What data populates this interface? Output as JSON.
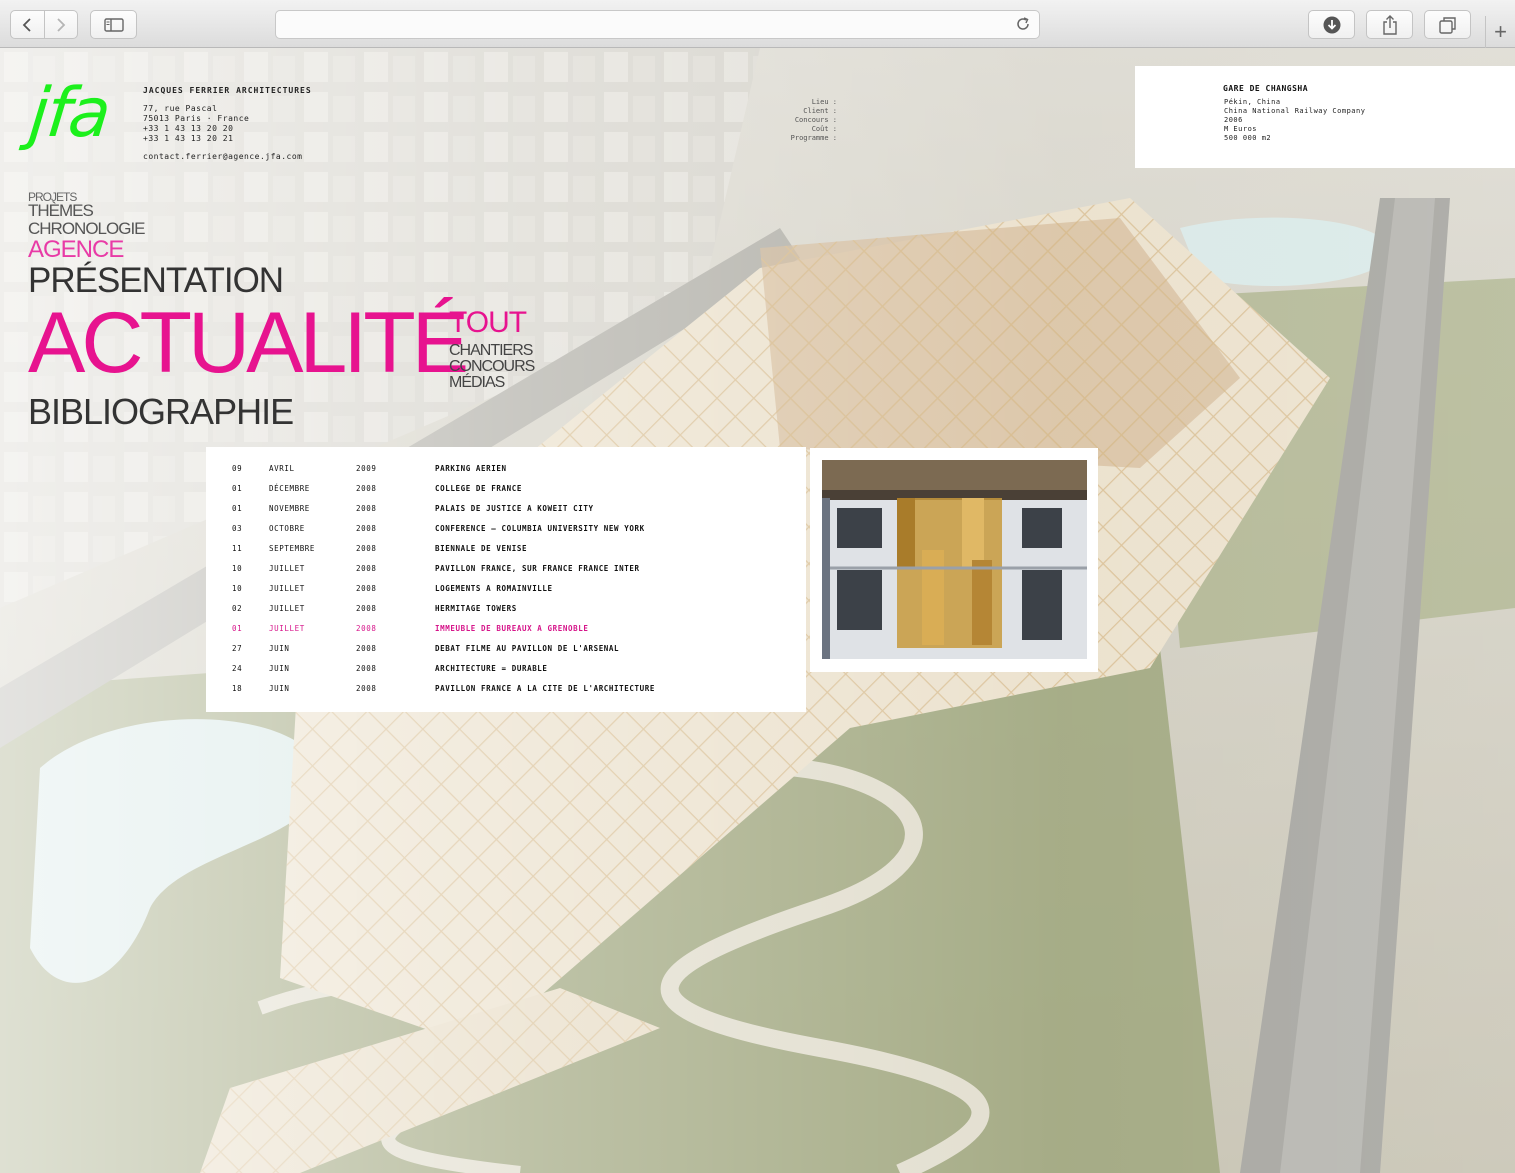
{
  "browser": {
    "back_icon": "chevron-left-icon",
    "forward_icon": "chevron-right-icon",
    "sidebar_icon": "sidebar-icon",
    "reload_icon": "reload-icon",
    "download_icon": "download-icon",
    "share_icon": "share-icon",
    "tabs_icon": "tabs-icon",
    "newtab_label": "+"
  },
  "header": {
    "logo": "jfa",
    "firm": "JACQUES FERRIER ARCHITECTURES",
    "street": "77, rue Pascal",
    "city": "75013 Paris · France",
    "phone": "+33 1 43 13 20 20",
    "fax": "+33 1 43 13 20 21",
    "email": "contact.ferrier@agence.jfa.com"
  },
  "nav": {
    "projets": "PROJETS",
    "themes": "THÈMES",
    "chronologie": "CHRONOLOGIE",
    "agence": "AGENCE",
    "presentation": "PRÉSENTATION",
    "actualite": "ACTUALITÉ",
    "bibliographie": "BIBLIOGRAPHIE",
    "sub": {
      "tout": "TOUT",
      "chantiers": "CHANTIERS",
      "concours": "CONCOURS",
      "medias": "MÉDIAS"
    }
  },
  "project": {
    "title": "GARE DE CHANGSHA",
    "fields": [
      {
        "label": "Lieu :",
        "value": "Pékin, China"
      },
      {
        "label": "Client :",
        "value": "China National Railway Company"
      },
      {
        "label": "Concours :",
        "value": "2006"
      },
      {
        "label": "Coût :",
        "value": "M Euros"
      },
      {
        "label": "Programme :",
        "value": "500 000 m2"
      }
    ]
  },
  "news": [
    {
      "day": "09",
      "month": "AVRIL",
      "year": "2009",
      "title": "PARKING AERIEN"
    },
    {
      "day": "01",
      "month": "DÉCEMBRE",
      "year": "2008",
      "title": "COLLEGE DE FRANCE"
    },
    {
      "day": "01",
      "month": "NOVEMBRE",
      "year": "2008",
      "title": "PALAIS DE JUSTICE A KOWEIT CITY"
    },
    {
      "day": "03",
      "month": "OCTOBRE",
      "year": "2008",
      "title": "CONFERENCE – COLUMBIA UNIVERSITY NEW YORK"
    },
    {
      "day": "11",
      "month": "SEPTEMBRE",
      "year": "2008",
      "title": "BIENNALE DE VENISE"
    },
    {
      "day": "10",
      "month": "JUILLET",
      "year": "2008",
      "title": "PAVILLON FRANCE, SUR FRANCE FRANCE INTER"
    },
    {
      "day": "10",
      "month": "JUILLET",
      "year": "2008",
      "title": "LOGEMENTS A ROMAINVILLE"
    },
    {
      "day": "02",
      "month": "JUILLET",
      "year": "2008",
      "title": "HERMITAGE TOWERS"
    },
    {
      "day": "01",
      "month": "JUILLET",
      "year": "2008",
      "title": "IMMEUBLE DE BUREAUX A GRENOBLE"
    },
    {
      "day": "27",
      "month": "JUIN",
      "year": "2008",
      "title": "DEBAT FILME AU PAVILLON DE L'ARSENAL"
    },
    {
      "day": "24",
      "month": "JUIN",
      "year": "2008",
      "title": "ARCHITECTURE = DURABLE"
    },
    {
      "day": "18",
      "month": "JUIN",
      "year": "2008",
      "title": "PAVILLON FRANCE A LA CITE DE L'ARCHITECTURE"
    }
  ],
  "active_news_index": 8,
  "colors": {
    "logo_green": "#1cf01c",
    "accent_magenta": "#e7138f",
    "agence_pink": "#e83aa6"
  }
}
